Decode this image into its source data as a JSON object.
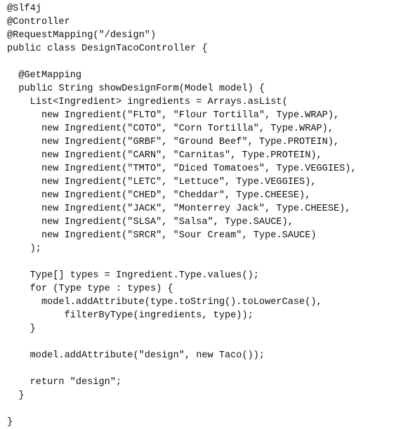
{
  "document": {
    "kind": "source-code-listing",
    "language": "Java",
    "class_name": "DesignTacoController",
    "background_color": "#ffffff",
    "text_color": "#101010",
    "font_size_px": 13.6,
    "line_height_px": 19,
    "syntax_highlighting": false,
    "line_numbers": false
  },
  "code": {
    "lines": [
      "@Slf4j",
      "@Controller",
      "@RequestMapping(\"/design\")",
      "public class DesignTacoController {",
      "",
      "  @GetMapping",
      "  public String showDesignForm(Model model) {",
      "    List<Ingredient> ingredients = Arrays.asList(",
      "      new Ingredient(\"FLTO\", \"Flour Tortilla\", Type.WRAP),",
      "      new Ingredient(\"COTO\", \"Corn Tortilla\", Type.WRAP),",
      "      new Ingredient(\"GRBF\", \"Ground Beef\", Type.PROTEIN),",
      "      new Ingredient(\"CARN\", \"Carnitas\", Type.PROTEIN),",
      "      new Ingredient(\"TMTO\", \"Diced Tomatoes\", Type.VEGGIES),",
      "      new Ingredient(\"LETC\", \"Lettuce\", Type.VEGGIES),",
      "      new Ingredient(\"CHED\", \"Cheddar\", Type.CHEESE),",
      "      new Ingredient(\"JACK\", \"Monterrey Jack\", Type.CHEESE),",
      "      new Ingredient(\"SLSA\", \"Salsa\", Type.SAUCE),",
      "      new Ingredient(\"SRCR\", \"Sour Cream\", Type.SAUCE)",
      "    );",
      "",
      "    Type[] types = Ingredient.Type.values();",
      "    for (Type type : types) {",
      "      model.addAttribute(type.toString().toLowerCase(),",
      "          filterByType(ingredients, type));",
      "    }",
      "",
      "    model.addAttribute(\"design\", new Taco());",
      "",
      "    return \"design\";",
      "  }",
      "",
      "}"
    ],
    "annotations": [
      "@Slf4j",
      "@Controller",
      "@RequestMapping",
      "@GetMapping"
    ],
    "ingredients": [
      {
        "code": "FLTO",
        "name": "Flour Tortilla",
        "type": "WRAP"
      },
      {
        "code": "COTO",
        "name": "Corn Tortilla",
        "type": "WRAP"
      },
      {
        "code": "GRBF",
        "name": "Ground Beef",
        "type": "PROTEIN"
      },
      {
        "code": "CARN",
        "name": "Carnitas",
        "type": "PROTEIN"
      },
      {
        "code": "TMTO",
        "name": "Diced Tomatoes",
        "type": "VEGGIES"
      },
      {
        "code": "LETC",
        "name": "Lettuce",
        "type": "VEGGIES"
      },
      {
        "code": "CHED",
        "name": "Cheddar",
        "type": "CHEESE"
      },
      {
        "code": "JACK",
        "name": "Monterrey Jack",
        "type": "CHEESE"
      },
      {
        "code": "SLSA",
        "name": "Salsa",
        "type": "SAUCE"
      },
      {
        "code": "SRCR",
        "name": "Sour Cream",
        "type": "SAUCE"
      }
    ],
    "mapping_path": "/design",
    "view_name": "design",
    "method_name": "showDesignForm",
    "model_attribute": "design"
  }
}
